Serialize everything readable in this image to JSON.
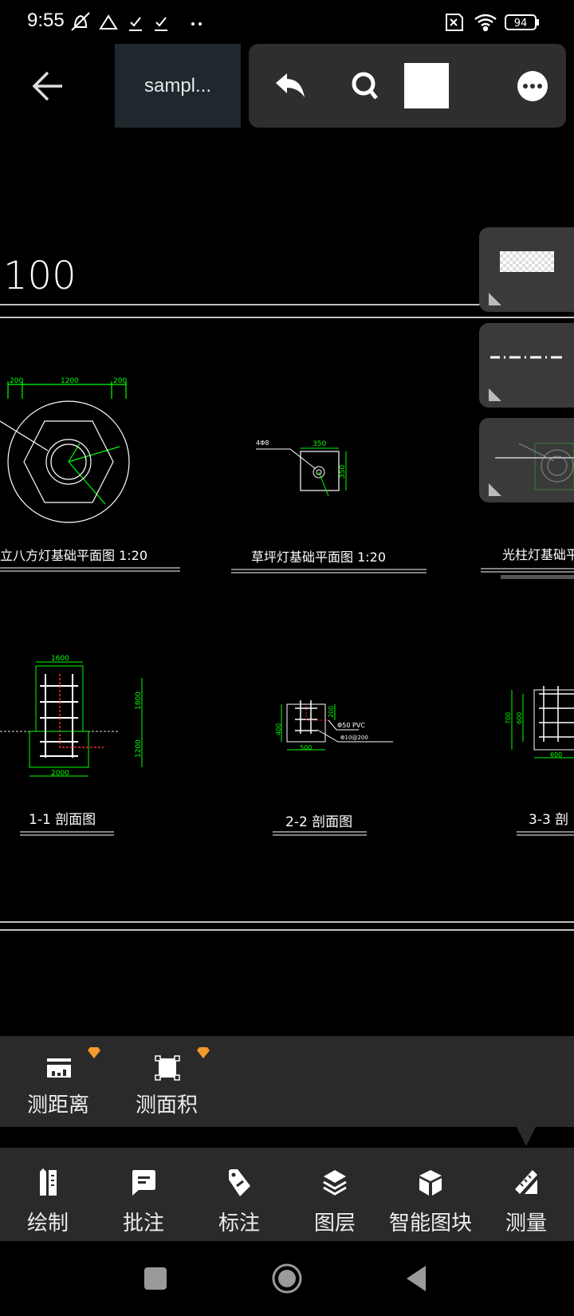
{
  "status_bar": {
    "time": "9:55",
    "battery": "94"
  },
  "header": {
    "file_title": "sampl...",
    "back_icon": "arrow-left-icon",
    "actions": [
      "undo-icon",
      "search-icon",
      "color-swatch",
      "more-icon"
    ]
  },
  "drawing": {
    "scale_text": "100",
    "plan_titles": [
      "立八方灯基础平面图 1:20",
      "草坪灯基础平面图 1:20",
      "光柱灯基础平面"
    ],
    "section_titles": [
      "1-1 剖面图",
      "2-2 剖面图",
      "3-3 剖"
    ],
    "dims_plan1": [
      "200",
      "1200",
      "200"
    ],
    "dims_plan2": [
      "350",
      "350"
    ],
    "plan2_note": "4Φ8",
    "dims_sec1": [
      "1600",
      "1800",
      "1200",
      "2000"
    ],
    "dims_sec2": [
      "400",
      "200",
      "500"
    ],
    "sec2_notes": [
      "Φ50 PVC",
      "Φ10@200"
    ],
    "dims_sec3": [
      "700",
      "600",
      "600"
    ]
  },
  "side_panels": [
    "fill-pattern",
    "line-type",
    "block-preview"
  ],
  "measure_tools": [
    {
      "label": "测距离",
      "icon": "measure-distance-icon",
      "premium": true
    },
    {
      "label": "测面积",
      "icon": "measure-area-icon",
      "premium": true
    }
  ],
  "bottom_tools": [
    {
      "label": "绘制",
      "icon": "draw-icon"
    },
    {
      "label": "批注",
      "icon": "comment-icon"
    },
    {
      "label": "标注",
      "icon": "tag-icon"
    },
    {
      "label": "图层",
      "icon": "layers-icon"
    },
    {
      "label": "智能图块",
      "icon": "cube-icon"
    },
    {
      "label": "测量",
      "icon": "ruler-icon",
      "active": true
    }
  ],
  "colors": {
    "cad_dim": "#00ff00",
    "cad_line": "#ffffff",
    "toolbar_bg": "#2e2e2e",
    "badge": "#f39a2b"
  }
}
